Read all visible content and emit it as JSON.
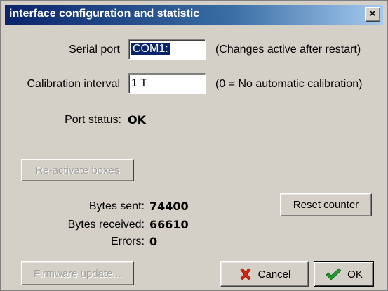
{
  "window": {
    "title": "interface configuration and statistic",
    "close_glyph": "×"
  },
  "serial_port": {
    "label": "Serial port",
    "value": "COM1:",
    "note": "(Changes active after restart)"
  },
  "calibration": {
    "label": "Calibration interval",
    "value": "1 T",
    "note": "(0 = No automatic calibration)"
  },
  "port_status": {
    "label": "Port status:",
    "value": "OK"
  },
  "buttons": {
    "reactivate": "Re-activate boxes",
    "reset_counter": "Reset counter",
    "firmware_update": "Firmware update...",
    "cancel": "Cancel",
    "ok": "OK"
  },
  "stats": {
    "bytes_sent_label": "Bytes sent:",
    "bytes_sent_value": "74400",
    "bytes_received_label": "Bytes received:",
    "bytes_received_value": "66610",
    "errors_label": "Errors:",
    "errors_value": "0"
  },
  "icons": {
    "cancel": "x-mark-icon",
    "ok": "checkmark-icon"
  },
  "colors": {
    "title_start": "#0a246a",
    "title_end": "#a6caf0",
    "dialog_bg": "#d4d0c8",
    "cancel_icon": "#d22a12",
    "ok_icon": "#1f9a2a"
  }
}
